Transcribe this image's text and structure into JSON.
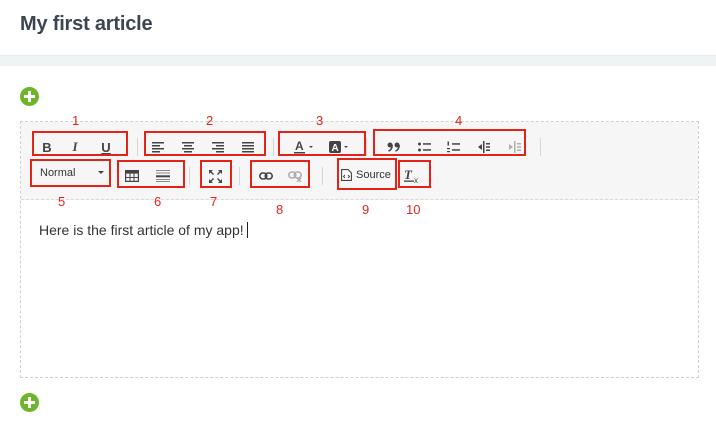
{
  "page": {
    "title": "My first article"
  },
  "editor": {
    "content": "Here is the first article of my app!",
    "format_select": {
      "value": "Normal"
    },
    "source_label": "Source"
  },
  "annotations": [
    "1",
    "2",
    "3",
    "4",
    "5",
    "6",
    "7",
    "8",
    "9",
    "10"
  ],
  "colors": {
    "accent_green": "#6fb52c",
    "annotation_red": "#e2231a",
    "title": "#3a4651"
  },
  "icons": {
    "bold": "B",
    "italic": "I",
    "underline": "U",
    "add": "plus-icon",
    "maximize": "maximize-icon",
    "link": "link-icon",
    "unlink": "unlink-icon",
    "clear_format": "Tx"
  }
}
